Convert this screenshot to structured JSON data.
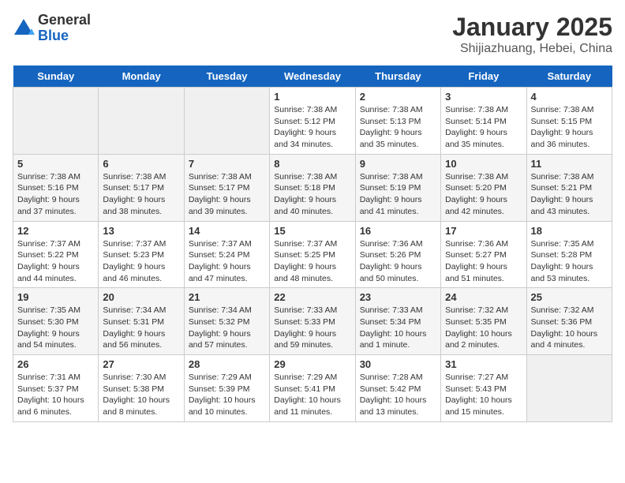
{
  "header": {
    "logo_general": "General",
    "logo_blue": "Blue",
    "title": "January 2025",
    "subtitle": "Shijiazhuang, Hebei, China"
  },
  "days": [
    "Sunday",
    "Monday",
    "Tuesday",
    "Wednesday",
    "Thursday",
    "Friday",
    "Saturday"
  ],
  "weeks": [
    [
      {
        "date": "",
        "info": ""
      },
      {
        "date": "",
        "info": ""
      },
      {
        "date": "",
        "info": ""
      },
      {
        "date": "1",
        "info": "Sunrise: 7:38 AM\nSunset: 5:12 PM\nDaylight: 9 hours\nand 34 minutes."
      },
      {
        "date": "2",
        "info": "Sunrise: 7:38 AM\nSunset: 5:13 PM\nDaylight: 9 hours\nand 35 minutes."
      },
      {
        "date": "3",
        "info": "Sunrise: 7:38 AM\nSunset: 5:14 PM\nDaylight: 9 hours\nand 35 minutes."
      },
      {
        "date": "4",
        "info": "Sunrise: 7:38 AM\nSunset: 5:15 PM\nDaylight: 9 hours\nand 36 minutes."
      }
    ],
    [
      {
        "date": "5",
        "info": "Sunrise: 7:38 AM\nSunset: 5:16 PM\nDaylight: 9 hours\nand 37 minutes."
      },
      {
        "date": "6",
        "info": "Sunrise: 7:38 AM\nSunset: 5:17 PM\nDaylight: 9 hours\nand 38 minutes."
      },
      {
        "date": "7",
        "info": "Sunrise: 7:38 AM\nSunset: 5:17 PM\nDaylight: 9 hours\nand 39 minutes."
      },
      {
        "date": "8",
        "info": "Sunrise: 7:38 AM\nSunset: 5:18 PM\nDaylight: 9 hours\nand 40 minutes."
      },
      {
        "date": "9",
        "info": "Sunrise: 7:38 AM\nSunset: 5:19 PM\nDaylight: 9 hours\nand 41 minutes."
      },
      {
        "date": "10",
        "info": "Sunrise: 7:38 AM\nSunset: 5:20 PM\nDaylight: 9 hours\nand 42 minutes."
      },
      {
        "date": "11",
        "info": "Sunrise: 7:38 AM\nSunset: 5:21 PM\nDaylight: 9 hours\nand 43 minutes."
      }
    ],
    [
      {
        "date": "12",
        "info": "Sunrise: 7:37 AM\nSunset: 5:22 PM\nDaylight: 9 hours\nand 44 minutes."
      },
      {
        "date": "13",
        "info": "Sunrise: 7:37 AM\nSunset: 5:23 PM\nDaylight: 9 hours\nand 46 minutes."
      },
      {
        "date": "14",
        "info": "Sunrise: 7:37 AM\nSunset: 5:24 PM\nDaylight: 9 hours\nand 47 minutes."
      },
      {
        "date": "15",
        "info": "Sunrise: 7:37 AM\nSunset: 5:25 PM\nDaylight: 9 hours\nand 48 minutes."
      },
      {
        "date": "16",
        "info": "Sunrise: 7:36 AM\nSunset: 5:26 PM\nDaylight: 9 hours\nand 50 minutes."
      },
      {
        "date": "17",
        "info": "Sunrise: 7:36 AM\nSunset: 5:27 PM\nDaylight: 9 hours\nand 51 minutes."
      },
      {
        "date": "18",
        "info": "Sunrise: 7:35 AM\nSunset: 5:28 PM\nDaylight: 9 hours\nand 53 minutes."
      }
    ],
    [
      {
        "date": "19",
        "info": "Sunrise: 7:35 AM\nSunset: 5:30 PM\nDaylight: 9 hours\nand 54 minutes."
      },
      {
        "date": "20",
        "info": "Sunrise: 7:34 AM\nSunset: 5:31 PM\nDaylight: 9 hours\nand 56 minutes."
      },
      {
        "date": "21",
        "info": "Sunrise: 7:34 AM\nSunset: 5:32 PM\nDaylight: 9 hours\nand 57 minutes."
      },
      {
        "date": "22",
        "info": "Sunrise: 7:33 AM\nSunset: 5:33 PM\nDaylight: 9 hours\nand 59 minutes."
      },
      {
        "date": "23",
        "info": "Sunrise: 7:33 AM\nSunset: 5:34 PM\nDaylight: 10 hours\nand 1 minute."
      },
      {
        "date": "24",
        "info": "Sunrise: 7:32 AM\nSunset: 5:35 PM\nDaylight: 10 hours\nand 2 minutes."
      },
      {
        "date": "25",
        "info": "Sunrise: 7:32 AM\nSunset: 5:36 PM\nDaylight: 10 hours\nand 4 minutes."
      }
    ],
    [
      {
        "date": "26",
        "info": "Sunrise: 7:31 AM\nSunset: 5:37 PM\nDaylight: 10 hours\nand 6 minutes."
      },
      {
        "date": "27",
        "info": "Sunrise: 7:30 AM\nSunset: 5:38 PM\nDaylight: 10 hours\nand 8 minutes."
      },
      {
        "date": "28",
        "info": "Sunrise: 7:29 AM\nSunset: 5:39 PM\nDaylight: 10 hours\nand 10 minutes."
      },
      {
        "date": "29",
        "info": "Sunrise: 7:29 AM\nSunset: 5:41 PM\nDaylight: 10 hours\nand 11 minutes."
      },
      {
        "date": "30",
        "info": "Sunrise: 7:28 AM\nSunset: 5:42 PM\nDaylight: 10 hours\nand 13 minutes."
      },
      {
        "date": "31",
        "info": "Sunrise: 7:27 AM\nSunset: 5:43 PM\nDaylight: 10 hours\nand 15 minutes."
      },
      {
        "date": "",
        "info": ""
      }
    ]
  ]
}
